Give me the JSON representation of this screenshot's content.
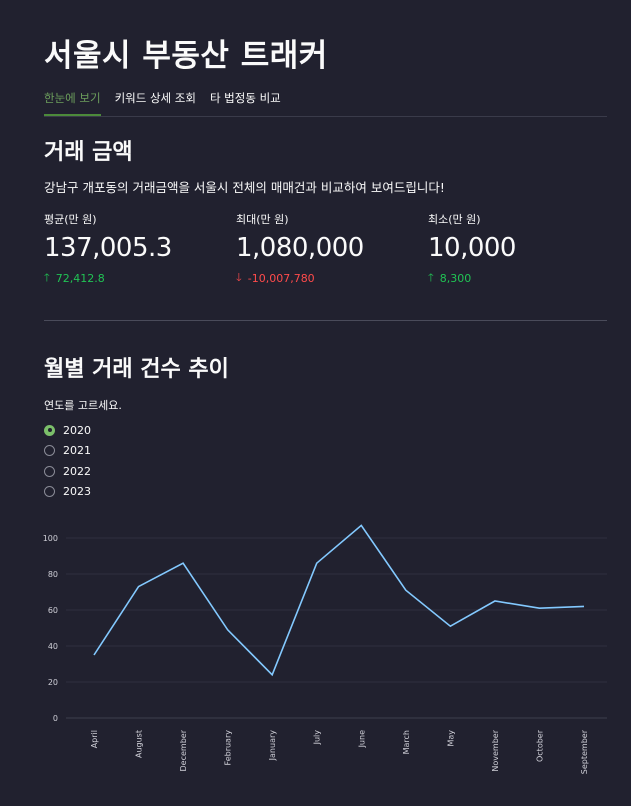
{
  "app": {
    "title": "서울시 부동산 트래커"
  },
  "tabs": [
    {
      "label": "한눈에 보기",
      "active": true
    },
    {
      "label": "키워드 상세 조회",
      "active": false
    },
    {
      "label": "타 법정동 비교",
      "active": false
    }
  ],
  "trade": {
    "heading": "거래 금액",
    "description": "강남구 개포동의 거래금액을 서울시 전체의 매매건과 비교하여 보여드립니다!",
    "metrics": [
      {
        "label": "평균(만 원)",
        "value": "137,005.3",
        "delta": "72,412.8",
        "direction": "up"
      },
      {
        "label": "최대(만 원)",
        "value": "1,080,000",
        "delta": "-10,007,780",
        "direction": "down"
      },
      {
        "label": "최소(만 원)",
        "value": "10,000",
        "delta": "8,300",
        "direction": "up"
      }
    ],
    "colors": {
      "up": "#21c354",
      "down": "#ff4b4b"
    }
  },
  "monthly": {
    "heading": "월별 거래 건수 추이",
    "radio_label": "연도를 고르세요.",
    "options": [
      "2020",
      "2021",
      "2022",
      "2023"
    ],
    "selected": "2020"
  },
  "chart_data": {
    "type": "line",
    "categories": [
      "April",
      "August",
      "December",
      "February",
      "January",
      "July",
      "June",
      "March",
      "May",
      "November",
      "October",
      "September"
    ],
    "values": [
      35,
      73,
      86,
      49,
      24,
      86,
      107,
      71,
      51,
      65,
      61,
      62
    ],
    "ylim": [
      0,
      110
    ],
    "yticks": [
      0,
      20,
      40,
      60,
      80,
      100
    ],
    "line_color": "#83c9ff",
    "grid": true
  }
}
